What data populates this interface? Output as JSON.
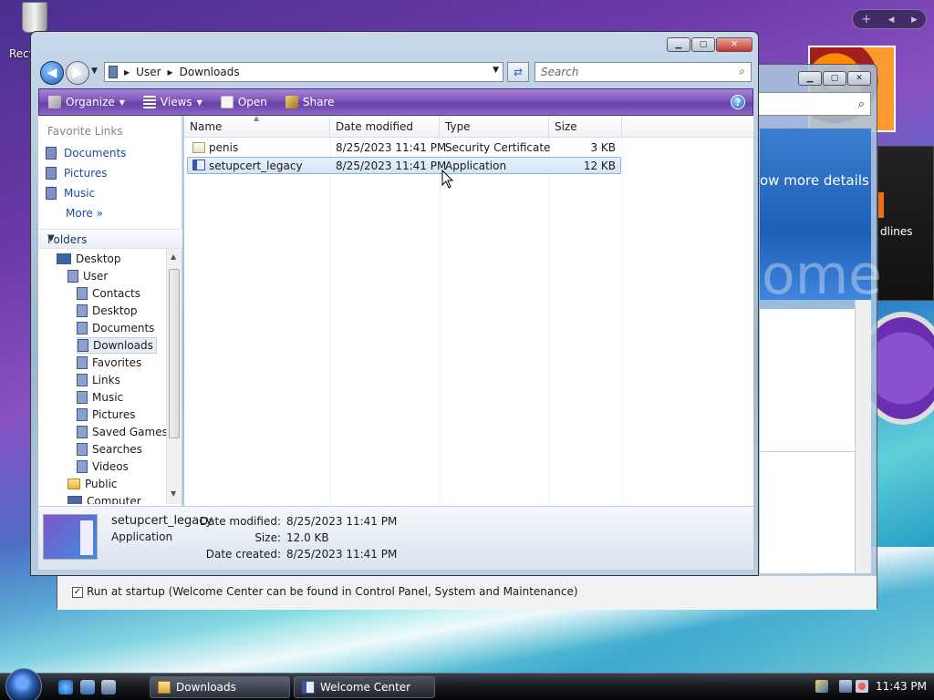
{
  "desktop": {
    "recycle_label": "Recy"
  },
  "sidebar_gadgets": {
    "control_plus": "+",
    "control_prev": "◂",
    "control_next": "▸",
    "feed_text": "dlines"
  },
  "welcome_center": {
    "banner_more_text": "ow more details",
    "banner_big_text": "ome",
    "startup_checkbox": "Run at startup (Welcome Center can be found in Control Panel, System and Maintenance)"
  },
  "explorer": {
    "address": {
      "segments": [
        "User",
        "Downloads"
      ]
    },
    "search": {
      "placeholder": "Search"
    },
    "toolbar": {
      "organize": "Organize",
      "views": "Views",
      "open": "Open",
      "share": "Share"
    },
    "nav_pane": {
      "favorite_links_header": "Favorite Links",
      "favorites": [
        "Documents",
        "Pictures",
        "Music"
      ],
      "more": "More",
      "folders_header": "Folders",
      "tree": [
        {
          "label": "Desktop",
          "level": 0
        },
        {
          "label": "User",
          "level": 1
        },
        {
          "label": "Contacts",
          "level": 2
        },
        {
          "label": "Desktop",
          "level": 2
        },
        {
          "label": "Documents",
          "level": 2
        },
        {
          "label": "Downloads",
          "level": 2,
          "selected": true
        },
        {
          "label": "Favorites",
          "level": 2
        },
        {
          "label": "Links",
          "level": 2
        },
        {
          "label": "Music",
          "level": 2
        },
        {
          "label": "Pictures",
          "level": 2
        },
        {
          "label": "Saved Games",
          "level": 2
        },
        {
          "label": "Searches",
          "level": 2
        },
        {
          "label": "Videos",
          "level": 2
        },
        {
          "label": "Public",
          "level": 1
        },
        {
          "label": "Computer",
          "level": 1
        }
      ]
    },
    "columns": [
      "Name",
      "Date modified",
      "Type",
      "Size"
    ],
    "files": [
      {
        "name": "penis",
        "date": "8/25/2023 11:41 PM",
        "type": "Security Certificate",
        "size": "3 KB",
        "selected": false
      },
      {
        "name": "setupcert_legacy",
        "date": "8/25/2023 11:41 PM",
        "type": "Application",
        "size": "12 KB",
        "selected": true
      }
    ],
    "details": {
      "name": "setupcert_legacy",
      "type": "Application",
      "date_modified_label": "Date modified:",
      "date_modified": "8/25/2023 11:41 PM",
      "size_label": "Size:",
      "size": "12.0 KB",
      "date_created_label": "Date created:",
      "date_created": "8/25/2023 11:41 PM"
    }
  },
  "taskbar": {
    "buttons": [
      "Downloads",
      "Welcome Center"
    ],
    "clock": "11:43 PM"
  }
}
